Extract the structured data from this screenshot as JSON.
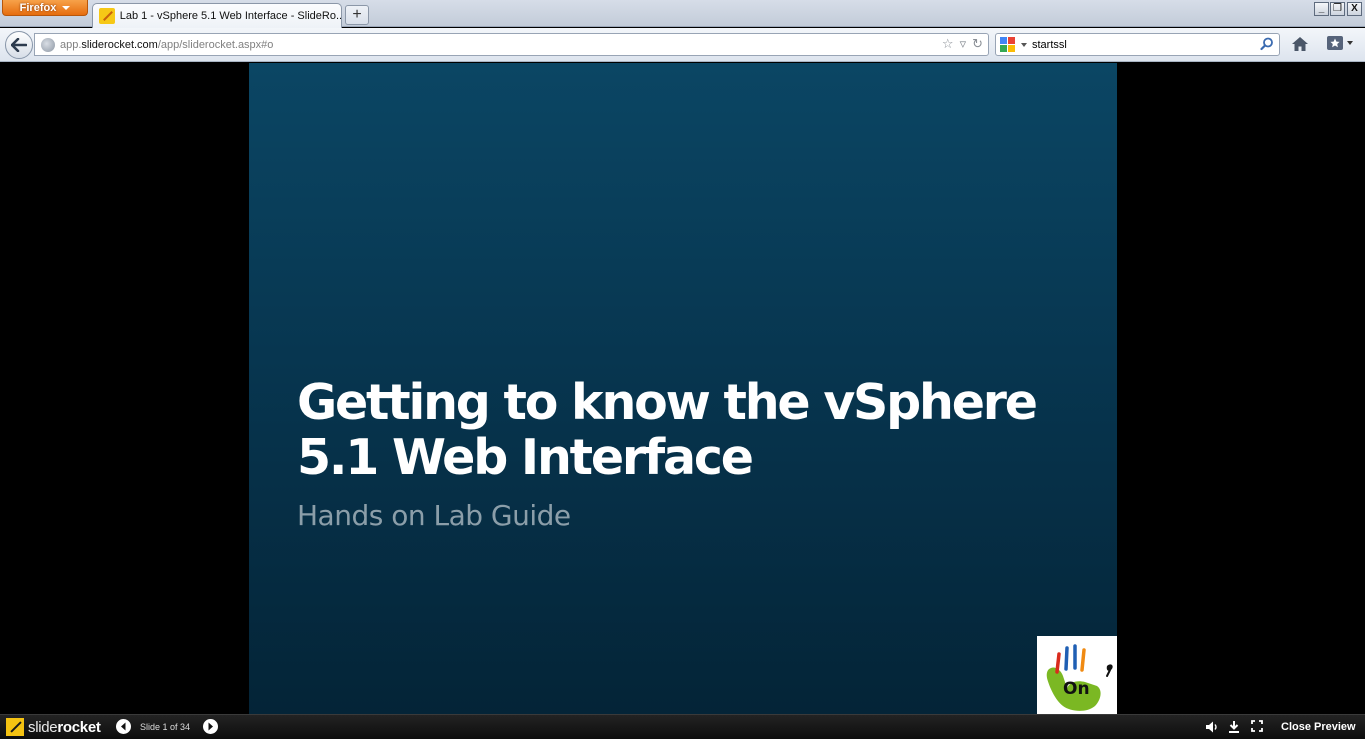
{
  "browser": {
    "app_button": "Firefox",
    "tab_title": "Lab 1 - vSphere 5.1 Web Interface - SlideRo...",
    "new_tab": "+",
    "url": {
      "scheme_host_prefix": "app.",
      "domain": "sliderocket.com",
      "path": "/app/sliderocket.aspx#o"
    },
    "search_query": "startssl",
    "window_controls": [
      "_",
      "❐",
      "X"
    ]
  },
  "slide": {
    "title": "Getting to know the vSphere 5.1 Web Interface",
    "subtitle": "Hands on Lab Guide",
    "logo_text": "On",
    "colors": {
      "top": "#0b4664",
      "bottom": "#042437",
      "subtitle": "#8b9ea9"
    }
  },
  "player": {
    "brand_light": "slide",
    "brand_bold": "rocket",
    "slide_counter": "Slide 1 of 34",
    "close_label": "Close Preview",
    "icons": [
      "volume-icon",
      "download-icon",
      "fullscreen-icon"
    ]
  }
}
